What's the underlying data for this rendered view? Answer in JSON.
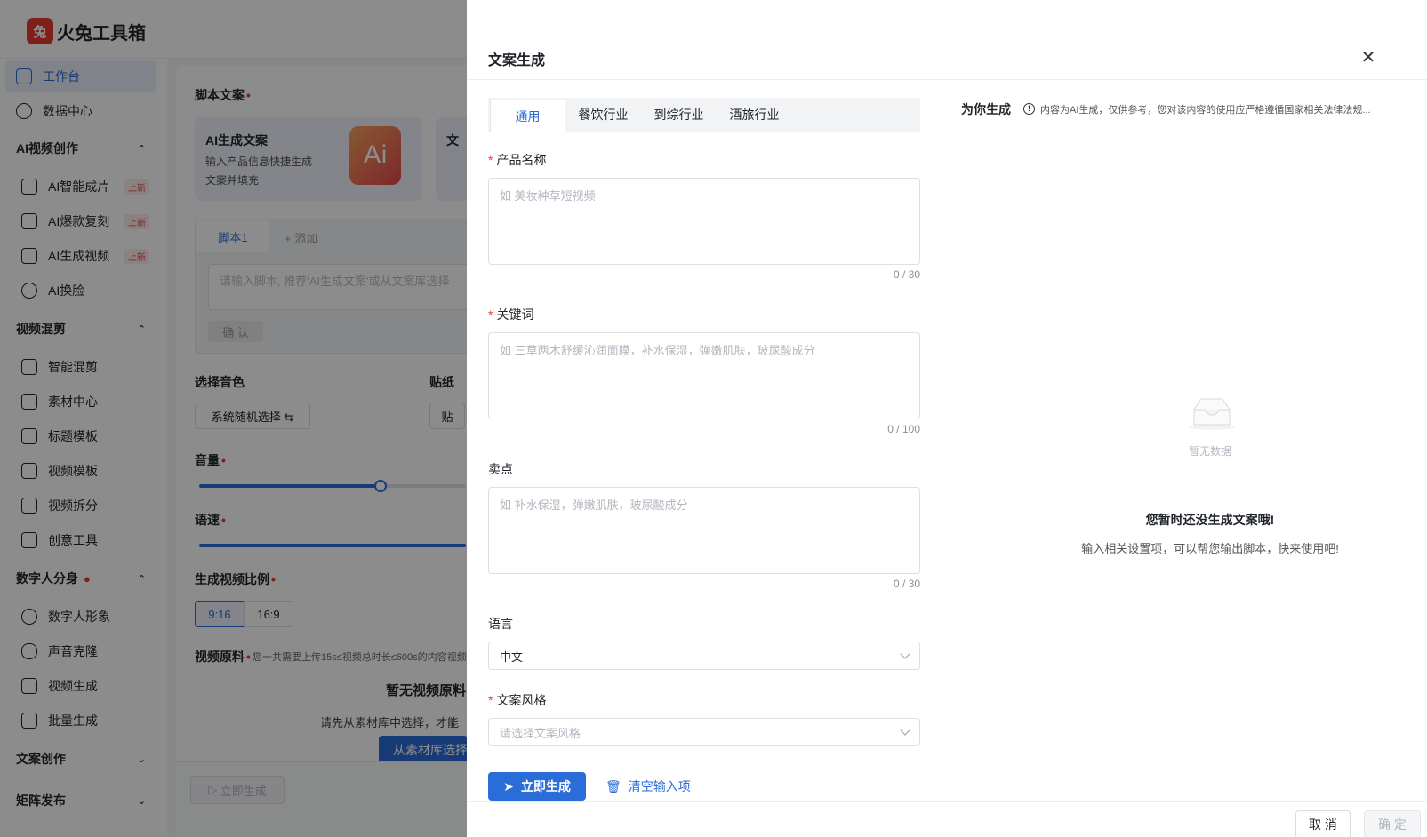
{
  "app": {
    "name": "火兔工具箱",
    "logo_glyph": "兔"
  },
  "sidebar": {
    "items": [
      {
        "label": "工作台",
        "icon": "monitor-icon",
        "active": true
      },
      {
        "label": "数据中心",
        "icon": "chart-pie-icon"
      }
    ],
    "groups": {
      "ai_video": {
        "title": "AI视频创作",
        "items": [
          {
            "label": "AI智能成片",
            "badge": "上新"
          },
          {
            "label": "AI爆款复刻",
            "badge": "上新"
          },
          {
            "label": "AI生成视频",
            "badge": "上新"
          },
          {
            "label": "AI换脸"
          }
        ]
      },
      "mix": {
        "title": "视频混剪",
        "items": [
          {
            "label": "智能混剪"
          },
          {
            "label": "素材中心"
          },
          {
            "label": "标题模板"
          },
          {
            "label": "视频模板"
          },
          {
            "label": "视频拆分"
          },
          {
            "label": "创意工具"
          }
        ]
      },
      "digital": {
        "title": "数字人分身",
        "items": [
          {
            "label": "数字人形象"
          },
          {
            "label": "声音克隆"
          },
          {
            "label": "视频生成"
          },
          {
            "label": "批量生成"
          }
        ]
      },
      "copy": {
        "title": "文案创作"
      },
      "matrix": {
        "title": "矩阵发布"
      }
    }
  },
  "background": {
    "script_label": "脚本文案",
    "ai_card_title": "AI生成文案",
    "ai_card_desc": "输入产品信息快捷生成文案并填充",
    "ai_card_img": "Ai",
    "ai_card2_title": "文",
    "script_tab": "脚本1",
    "script_add": "+ 添加",
    "script_placeholder": "请输入脚本, 推荐'AI生成文案'或从文案库选择",
    "confirm": "确 认",
    "voice_label": "选择音色",
    "sticker_label": "贴纸",
    "voice_btn": "系统随机选择 ⇆",
    "sticker_btn": "贴",
    "volume_label": "音量",
    "volume_value": 0.68,
    "speed_label": "语速",
    "speed_value": 1.0,
    "ratio_label": "生成视频比例",
    "ratios": [
      "9:16",
      "16:9"
    ],
    "material_label": "视频原料",
    "material_note": "您一共需要上传15s≤视频总时长≤600s的内容视频",
    "empty_title": "暂无视频原料",
    "empty_desc": "请先从素材库中选择，才能",
    "lib_btn": "从素材库选择",
    "generate_btn": "立即生成"
  },
  "drawer": {
    "title": "文案生成",
    "tabs": [
      "通用",
      "餐饮行业",
      "到综行业",
      "酒旅行业"
    ],
    "active_tab": 0,
    "fields": {
      "product": {
        "label": "产品名称",
        "required": true,
        "placeholder": "如 美妆种草短视频",
        "count": "0 / 30"
      },
      "keywords": {
        "label": "关键词",
        "required": true,
        "placeholder": "如 三草两木舒缓沁润面膜，补水保湿，弹嫩肌肤，玻尿酸成分",
        "count": "0 / 100"
      },
      "selling": {
        "label": "卖点",
        "required": false,
        "placeholder": "如 补水保湿，弹嫩肌肤，玻尿酸成分",
        "count": "0 / 30"
      },
      "language": {
        "label": "语言",
        "value": "中文"
      },
      "style": {
        "label": "文案风格",
        "required": true,
        "placeholder": "请选择文案风格"
      }
    },
    "generate_btn": "立即生成",
    "clear_btn": "清空输入项",
    "result": {
      "title": "为你生成",
      "note": "内容为AI生成，仅供参考，您对该内容的使用应严格遵循国家相关法律法规...",
      "empty_label": "暂无数据",
      "empty_title": "您暂时还没生成文案哦!",
      "empty_desc": "输入相关设置项，可以帮您输出脚本，快来使用吧!"
    },
    "footer": {
      "cancel": "取 消",
      "confirm": "确 定"
    }
  },
  "colors": {
    "primary": "#2a6cd8",
    "danger": "#e23c3c",
    "mask": "rgba(0,0,0,0.45)"
  }
}
